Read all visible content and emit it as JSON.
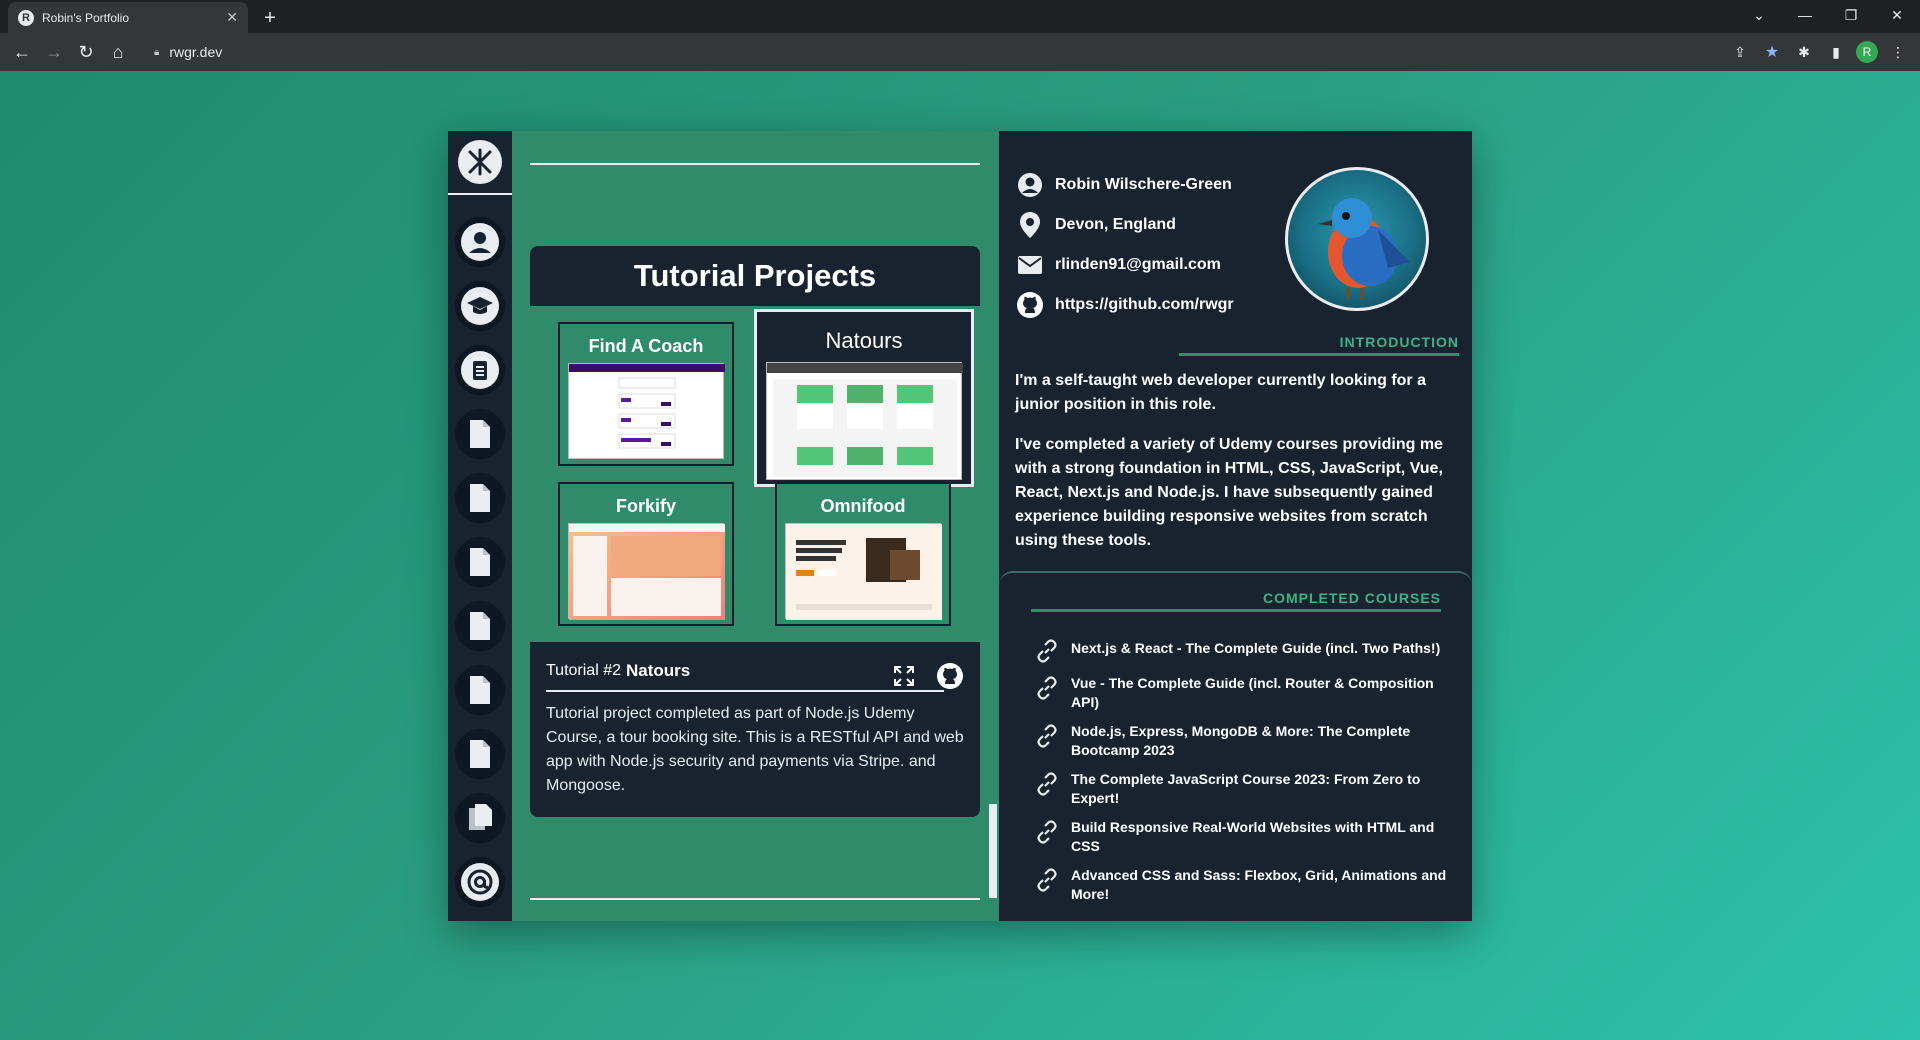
{
  "browser": {
    "tab_title": "Robin's Portfolio",
    "favicon_letter": "R",
    "url": "rwgr.dev",
    "profile_letter": "R"
  },
  "projects": {
    "heading": "Tutorial Projects",
    "items": [
      {
        "label": "Find A Coach"
      },
      {
        "label": "Natours"
      },
      {
        "label": "Forkify"
      },
      {
        "label": "Omnifood"
      }
    ],
    "detail": {
      "prefix": "Tutorial #2",
      "name": "Natours",
      "description": "Tutorial project completed as part of Node.js Udemy Course, a tour booking site. This is a RESTful API and web app with Node.js security and payments via Stripe. and Mongoose."
    }
  },
  "profile": {
    "name": "Robin Wilschere-Green",
    "location": "Devon, England",
    "email": "rlinden91@gmail.com",
    "github": "https://github.com/rwgr"
  },
  "introduction": {
    "title": "INTRODUCTION",
    "paragraphs": [
      "I'm a self-taught web developer currently looking for a junior position in this role.",
      "I've completed a variety of Udemy courses providing me with a strong foundation in HTML, CSS, JavaScript, Vue, React, Next.js and Node.js. I have subsequently gained experience building responsive websites from scratch using these tools."
    ]
  },
  "courses": {
    "title": "COMPLETED COURSES",
    "items": [
      "Next.js & React - The Complete Guide (incl. Two Paths!)",
      "Vue - The Complete Guide (incl. Router & Composition API)",
      "Node.js, Express, MongoDB & More: The Complete Bootcamp 2023",
      "The Complete JavaScript Course 2023: From Zero to Expert!",
      "Build Responsive Real-World Websites with HTML and CSS",
      "Advanced CSS and Sass: Flexbox, Grid, Animations and More!"
    ]
  },
  "colors": {
    "accent": "#3ab389",
    "panel_dark": "#18232f",
    "panel_green": "#2f8b6a"
  }
}
